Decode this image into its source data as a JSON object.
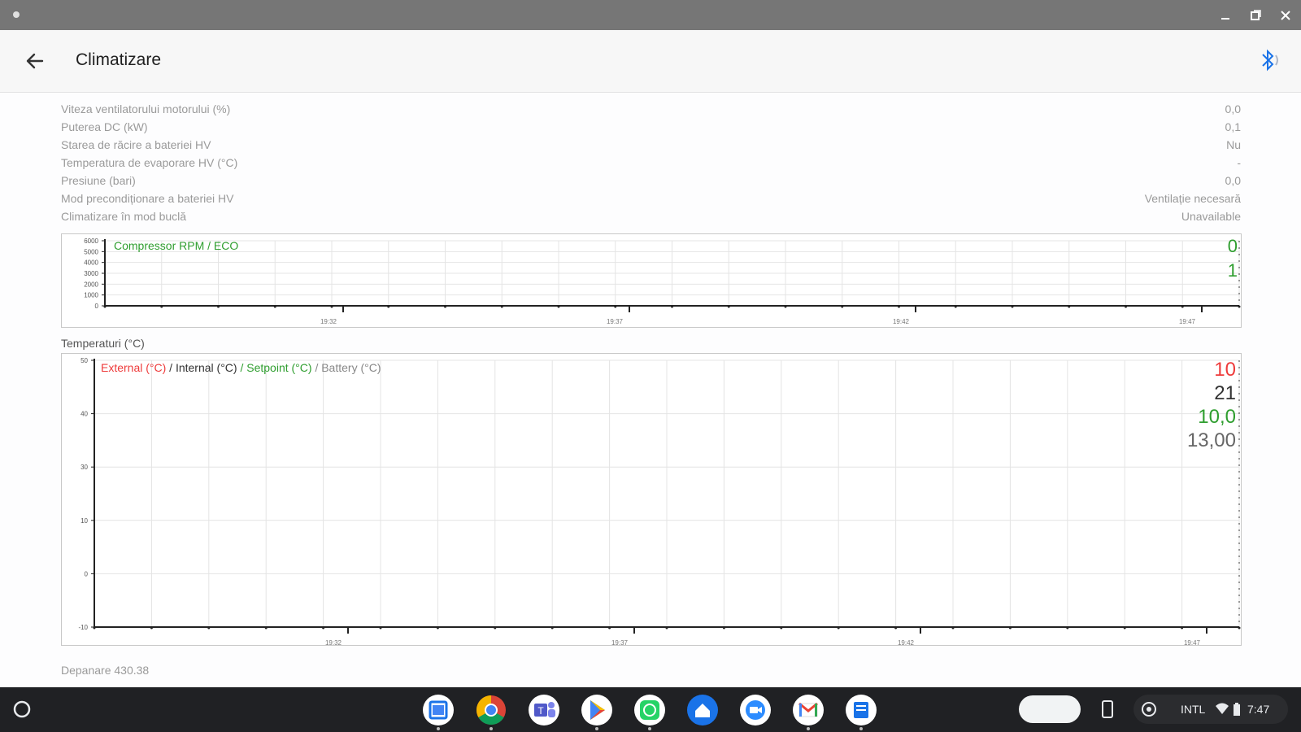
{
  "header": {
    "title": "Climatizare"
  },
  "rows": [
    {
      "label": "Viteza ventilatorului motorului (%)",
      "value": "0,0"
    },
    {
      "label": "Puterea DC (kW)",
      "value": "0,1"
    },
    {
      "label": "Starea de răcire a bateriei HV",
      "value": "Nu"
    },
    {
      "label": "Temperatura de evaporare HV (°C)",
      "value": "-"
    },
    {
      "label": "Presiune (bari)",
      "value": "0,0"
    },
    {
      "label": "Mod precondiționare a bateriei HV",
      "value": "Ventilație necesară"
    },
    {
      "label": "Climatizare în mod buclă",
      "value": "Unavailable"
    }
  ],
  "section": {
    "temperatures_title": "Temperaturi (°C)"
  },
  "footer": {
    "text": "Depanare 430.38"
  },
  "colors": {
    "red": "#ee3b3b",
    "green": "#2f9e2f",
    "dark": "#333333",
    "gray": "#777777",
    "accent": "#1a73e8"
  },
  "taskbar": {
    "apps": [
      "google-calendar-icon",
      "chrome-icon",
      "teams-icon",
      "play-store-icon",
      "whatsapp-icon",
      "home-icon",
      "zoom-icon",
      "gmail-icon",
      "files-icon"
    ],
    "status": {
      "ime": "INTL",
      "time": "7:47"
    }
  },
  "chart_data": [
    {
      "type": "line",
      "title": "",
      "legend": [
        "Compressor RPM",
        "/ ECO"
      ],
      "y_ticks": [
        "6000",
        "5000",
        "4000",
        "3000",
        "2000",
        "1000",
        "0"
      ],
      "ylim": [
        0,
        6000
      ],
      "x_ticks": [
        "19:32",
        "19:37",
        "19:42",
        "19:47"
      ],
      "grid": true,
      "current_values": [
        "0",
        "1"
      ],
      "series": []
    },
    {
      "type": "line",
      "title": "Temperaturi (°C)",
      "legend": [
        "External (°C)",
        "/ Internal (°C)",
        "/ Setpoint (°C)",
        "/ Battery (°C)"
      ],
      "y_ticks": [
        "50",
        "40",
        "30",
        "10",
        "0",
        "-10"
      ],
      "ylim": [
        -10,
        50
      ],
      "x_ticks": [
        "19:32",
        "19:37",
        "19:42",
        "19:47"
      ],
      "grid": true,
      "current_values": [
        "10",
        "21",
        "10,0",
        "13,00"
      ],
      "series": []
    }
  ]
}
